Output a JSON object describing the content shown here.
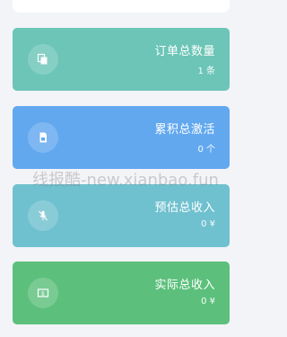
{
  "cards": [
    {
      "title": "订单总数量",
      "value": "1 条",
      "icon": "copy-icon",
      "color": "#6cc5b7"
    },
    {
      "title": "累积总激活",
      "value": "0 个",
      "icon": "sim-card-icon",
      "color": "#62a8ef"
    },
    {
      "title": "预估总收入",
      "value": "0 ¥",
      "icon": "microphone-off-icon",
      "color": "#70c1cf"
    },
    {
      "title": "实际总收入",
      "value": "0 ¥",
      "icon": "dollar-bill-icon",
      "color": "#5cc07c"
    }
  ],
  "watermark": "线报酷-new.xianbao.fun"
}
